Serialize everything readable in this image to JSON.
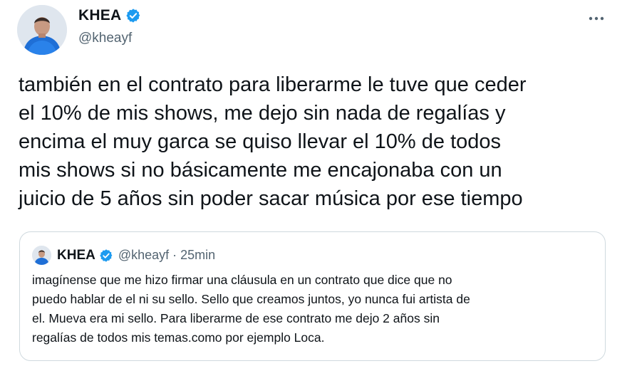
{
  "tweet": {
    "author_name": "KHEA",
    "author_handle": "@kheayf",
    "avatar_icon": "profile-photo",
    "verified_icon": "verified-badge-icon",
    "more_icon": "more-options-icon",
    "text": "también en el contrato para liberarme le tuve que ceder\nel 10% de mis shows, me dejo sin nada de regalías y\nencima el muy garca se quiso llevar el 10% de todos\nmis shows si no básicamente me encajonaba con un\njuicio de 5 años sin poder sacar música por ese tiempo"
  },
  "quoted_tweet": {
    "author_name": "KHEA",
    "author_handle": "@kheayf",
    "separator": "·",
    "timestamp": "25min",
    "text": "imagínense que me hizo firmar una cláusula en un contrato que dice que no\npuedo hablar de el ni su sello. Sello que creamos juntos, yo nunca fui artista de\nel. Mueva era mi sello. Para liberarme de ese contrato me dejo 2 años sin\nregalías de todos mis temas.como por ejemplo Loca."
  },
  "colors": {
    "text_primary": "#0f1419",
    "text_secondary": "#536471",
    "verified_blue": "#1d9bf0",
    "border": "#cfd9de"
  }
}
